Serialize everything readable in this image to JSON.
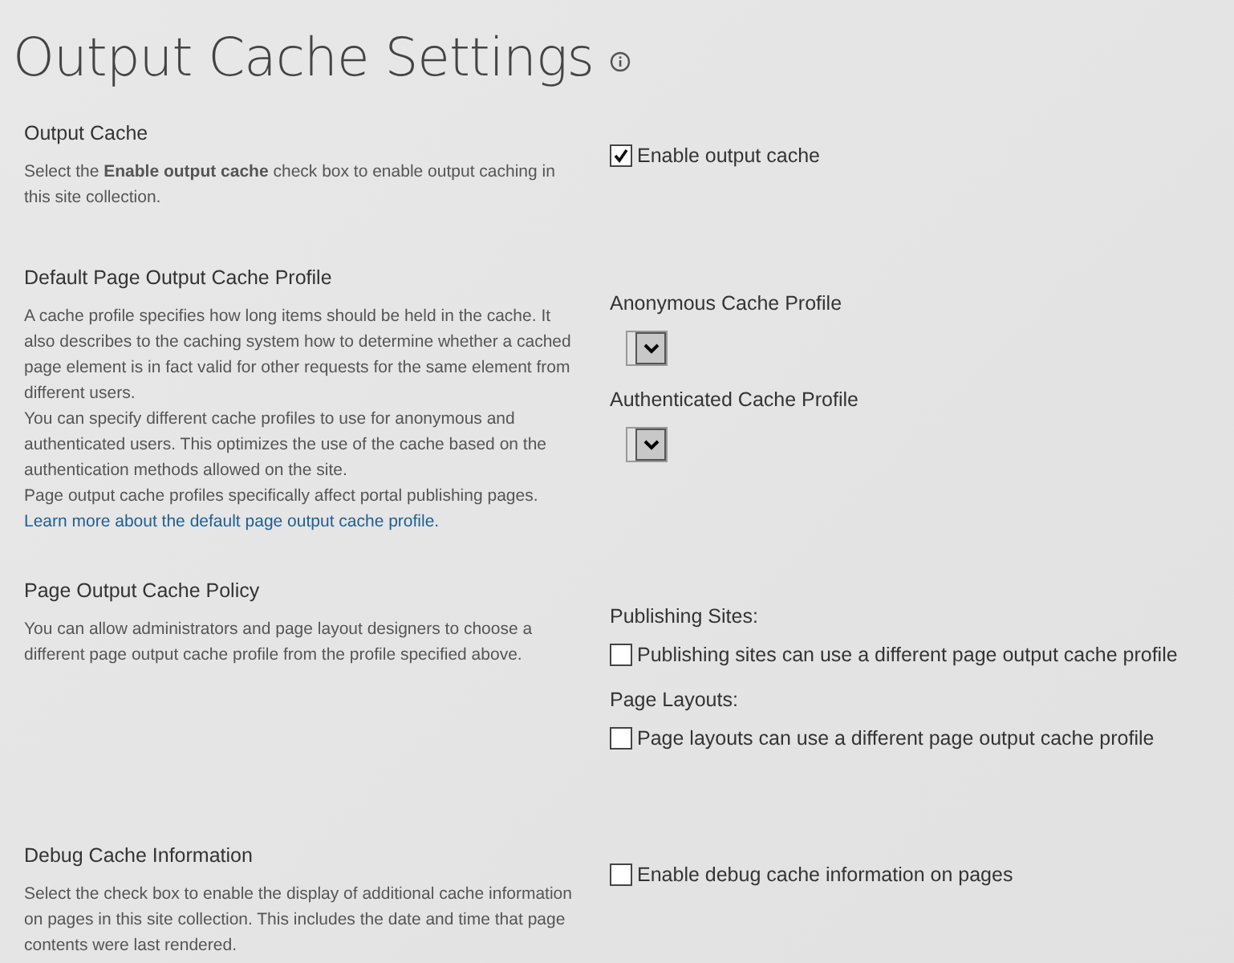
{
  "title": "Output Cache Settings",
  "sections": [
    {
      "heading": "Output Cache",
      "description": [
        {
          "text": "Select the **Enable output cache** check box to enable output caching in this site collection."
        }
      ],
      "controls": [
        {
          "kind": "checkbox",
          "label": "Enable output cache",
          "checked": true
        }
      ]
    },
    {
      "heading": "Default Page Output Cache Profile",
      "description": [
        {
          "text": "A cache profile specifies how long items should be held in the cache. It also describes to the caching system how to determine whether a cached page element is in fact valid for other requests for the same element from different users."
        },
        {
          "text": "You can specify different cache profiles to use for anonymous and authenticated users. This optimizes the use of the cache based on the authentication methods allowed on the site."
        },
        {
          "text": "Page output cache profiles specifically affect portal publishing pages.",
          "link": "Learn more about the default page output cache profile."
        }
      ],
      "controls": [
        {
          "kind": "label",
          "label": "Anonymous Cache Profile"
        },
        {
          "kind": "dropdown"
        },
        {
          "kind": "label",
          "label": "Authenticated Cache Profile"
        },
        {
          "kind": "dropdown"
        }
      ]
    },
    {
      "heading": "Page Output Cache Policy",
      "description": [
        {
          "text": "You can allow administrators and page layout designers to choose a different page output cache profile from the profile specified above."
        }
      ],
      "controls": [
        {
          "kind": "label",
          "label": "Publishing Sites:"
        },
        {
          "kind": "checkbox",
          "label": "Publishing sites can use a different page output cache profile",
          "checked": false
        },
        {
          "kind": "label",
          "label": "Page Layouts:"
        },
        {
          "kind": "checkbox",
          "label": "Page layouts can use a different page output cache profile",
          "checked": false
        }
      ]
    },
    {
      "heading": "Debug Cache Information",
      "description": [
        {
          "text": "Select the check box to enable the display of additional cache information on pages in this site collection. This includes the date and time that page contents were last rendered."
        }
      ],
      "controls": [
        {
          "kind": "checkbox",
          "label": "Enable debug cache information on pages",
          "checked": false
        }
      ]
    }
  ]
}
